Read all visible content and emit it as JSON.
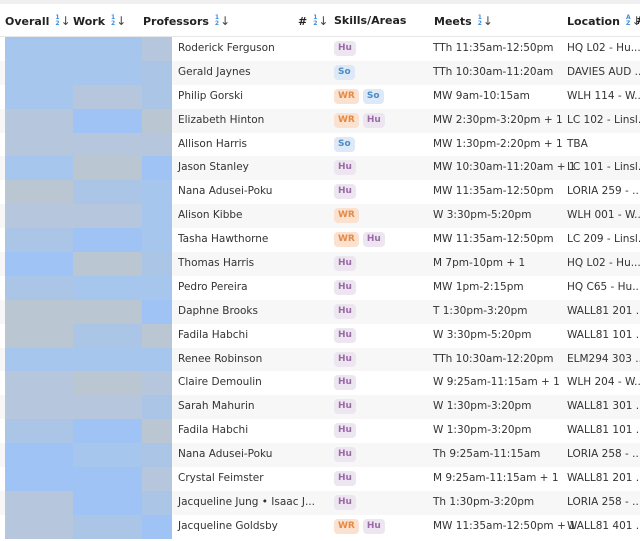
{
  "header": {
    "overall": "Overall",
    "work": "Work",
    "professors": "Professors",
    "number": "#",
    "skills": "Skills/Areas",
    "meets": "Meets",
    "location": "Location",
    "extra": "#",
    "sort_numeric_top": "1",
    "sort_numeric_bottom": "2",
    "sort_alpha_top": "A",
    "sort_alpha_bottom": "Z",
    "sort_arrow": "↓"
  },
  "rows": [
    {
      "overall": "s1",
      "work": "s1",
      "prof": "s3",
      "name": "Roderick Ferguson",
      "tags": [
        "Hu"
      ],
      "meets": "TTh 11:35am-12:50pm",
      "location": "HQ L02 - Hu..."
    },
    {
      "overall": "s1",
      "work": "s1",
      "prof": "s5",
      "name": "Gerald Jaynes",
      "tags": [
        "So"
      ],
      "meets": "TTh 10:30am-11:20am",
      "location": "DAVIES AUD ..."
    },
    {
      "overall": "s1",
      "work": "s3",
      "prof": "s5",
      "name": "Philip Gorski",
      "tags": [
        "WR",
        "So"
      ],
      "meets": "MW 9am-10:15am",
      "location": "WLH 114 - W..."
    },
    {
      "overall": "s3",
      "work": "s2",
      "prof": "s4",
      "name": "Elizabeth Hinton",
      "tags": [
        "WR",
        "Hu"
      ],
      "meets": "MW 2:30pm-3:20pm + 1",
      "location": "LC 102 - Linsl..."
    },
    {
      "overall": "s3",
      "work": "s3",
      "prof": "s3",
      "name": "Allison Harris",
      "tags": [
        "So"
      ],
      "meets": "MW 1:30pm-2:20pm + 1",
      "location": "TBA"
    },
    {
      "overall": "s1",
      "work": "s4",
      "prof": "s2",
      "name": "Jason Stanley",
      "tags": [
        "Hu"
      ],
      "meets": "MW 10:30am-11:20am + 1",
      "location": "LC 101 - Linsl..."
    },
    {
      "overall": "s4",
      "work": "s5",
      "prof": "s1",
      "name": "Nana Adusei-Poku",
      "tags": [
        "Hu"
      ],
      "meets": "MW 11:35am-12:50pm",
      "location": "LORIA 259 - ..."
    },
    {
      "overall": "s3",
      "work": "s3",
      "prof": "s1",
      "name": "Alison Kibbe",
      "tags": [
        "WR"
      ],
      "meets": "W 3:30pm-5:20pm",
      "location": "WLH 001 - W..."
    },
    {
      "overall": "s5",
      "work": "s2",
      "prof": "s1",
      "name": "Tasha Hawthorne",
      "tags": [
        "WR",
        "Hu"
      ],
      "meets": "MW 11:35am-12:50pm",
      "location": "LC 209 - Linsl..."
    },
    {
      "overall": "s2",
      "work": "s4",
      "prof": "s5",
      "name": "Thomas Harris",
      "tags": [
        "Hu"
      ],
      "meets": "M 7pm-10pm + 1",
      "location": "HQ L02 - Hu..."
    },
    {
      "overall": "s5",
      "work": "s1",
      "prof": "s1",
      "name": "Pedro Pereira",
      "tags": [
        "Hu"
      ],
      "meets": "MW 1pm-2:15pm",
      "location": "HQ C65 - Hu..."
    },
    {
      "overall": "s4",
      "work": "s4",
      "prof": "s2",
      "name": "Daphne Brooks",
      "tags": [
        "Hu"
      ],
      "meets": "T 1:30pm-3:20pm",
      "location": "WALL81 201 ..."
    },
    {
      "overall": "s4",
      "work": "s5",
      "prof": "s4",
      "name": "Fadila Habchi",
      "tags": [
        "Hu"
      ],
      "meets": "W 3:30pm-5:20pm",
      "location": "WALL81 101 ..."
    },
    {
      "overall": "s1",
      "work": "s1",
      "prof": "s1",
      "name": "Renee Robinson",
      "tags": [
        "Hu"
      ],
      "meets": "TTh 10:30am-12:20pm",
      "location": "ELM294 303 ..."
    },
    {
      "overall": "s3",
      "work": "s4",
      "prof": "s3",
      "name": "Claire Demoulin",
      "tags": [
        "Hu"
      ],
      "meets": "W 9:25am-11:15am + 1",
      "location": "WLH 204 - W..."
    },
    {
      "overall": "s3",
      "work": "s3",
      "prof": "s5",
      "name": "Sarah Mahurin",
      "tags": [
        "Hu"
      ],
      "meets": "W 1:30pm-3:20pm",
      "location": "WALL81 301 ..."
    },
    {
      "overall": "s5",
      "work": "s2",
      "prof": "s4",
      "name": "Fadila Habchi",
      "tags": [
        "Hu"
      ],
      "meets": "W 1:30pm-3:20pm",
      "location": "WALL81 101 ..."
    },
    {
      "overall": "s2",
      "work": "s1",
      "prof": "s5",
      "name": "Nana Adusei-Poku",
      "tags": [
        "Hu"
      ],
      "meets": "Th 9:25am-11:15am",
      "location": "LORIA 258 - ..."
    },
    {
      "overall": "s2",
      "work": "s2",
      "prof": "s3",
      "name": "Crystal Feimster",
      "tags": [
        "Hu"
      ],
      "meets": "M 9:25am-11:15am + 1",
      "location": "WALL81 201 ..."
    },
    {
      "overall": "s3",
      "work": "s2",
      "prof": "s5",
      "name": "Jacqueline Jung • Isaac J...",
      "tags": [
        "Hu"
      ],
      "meets": "Th 1:30pm-3:20pm",
      "location": "LORIA 258 - ..."
    },
    {
      "overall": "s3",
      "work": "s5",
      "prof": "s2",
      "name": "Jacqueline Goldsby",
      "tags": [
        "WR",
        "Hu"
      ],
      "meets": "MW 11:35am-12:50pm + 1",
      "location": "WALL81 401 ..."
    }
  ],
  "colors": {
    "tag_Hu_bg": "#ede6f0",
    "tag_Hu_fg": "#9b6aa8",
    "tag_So_bg": "#dde9f6",
    "tag_So_fg": "#4d8bc7",
    "tag_WR_bg": "#fbe1cf",
    "tag_WR_fg": "#e58a45",
    "sort_accent": "#3a8de0"
  }
}
